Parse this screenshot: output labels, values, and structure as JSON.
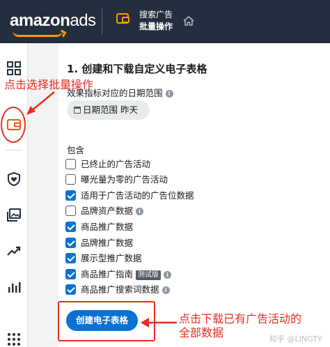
{
  "header": {
    "logo_main": "amazon",
    "logo_ads": "ads",
    "title_line1": "搜索广告",
    "title_line2": "批量操作",
    "accent_color": "#ff9900",
    "background_color": "#232f3e"
  },
  "sidebar": {
    "icons": [
      "grid-icon",
      "wallet-icon",
      "shield-heart-icon",
      "images-icon",
      "trend-icon",
      "bar-chart-icon",
      "apps-icon"
    ]
  },
  "main": {
    "step_title": "1. 创建和下载自定义电子表格",
    "date_range_label": "效果指标对应的日期范围",
    "date_chip": {
      "label": "日期范围",
      "value": "昨天"
    },
    "include_label": "包含",
    "options": [
      {
        "label": "已终止的广告活动",
        "checked": false
      },
      {
        "label": "曝光量为零的广告活动",
        "checked": false
      },
      {
        "label": "适用于广告活动的广告位数据",
        "checked": true
      },
      {
        "label": "品牌资产数据",
        "checked": false
      },
      {
        "label": "商品推广数据",
        "checked": true
      },
      {
        "label": "品牌推广数据",
        "checked": true
      },
      {
        "label": "展示型推广数据",
        "checked": true
      },
      {
        "label": "商品推广指南",
        "checked": true,
        "badge": "测试版"
      },
      {
        "label": "商品推广搜索词数据",
        "checked": true
      }
    ],
    "create_button": "创建电子表格",
    "primary_color": "#0972d3"
  },
  "annotations": {
    "select_bulk": "点击选择批量操作",
    "download_line1": "点击下载已有广告活动的",
    "download_line2": "全部数据",
    "color": "#e62d1f"
  },
  "watermark": "知乎 @LINGTY"
}
